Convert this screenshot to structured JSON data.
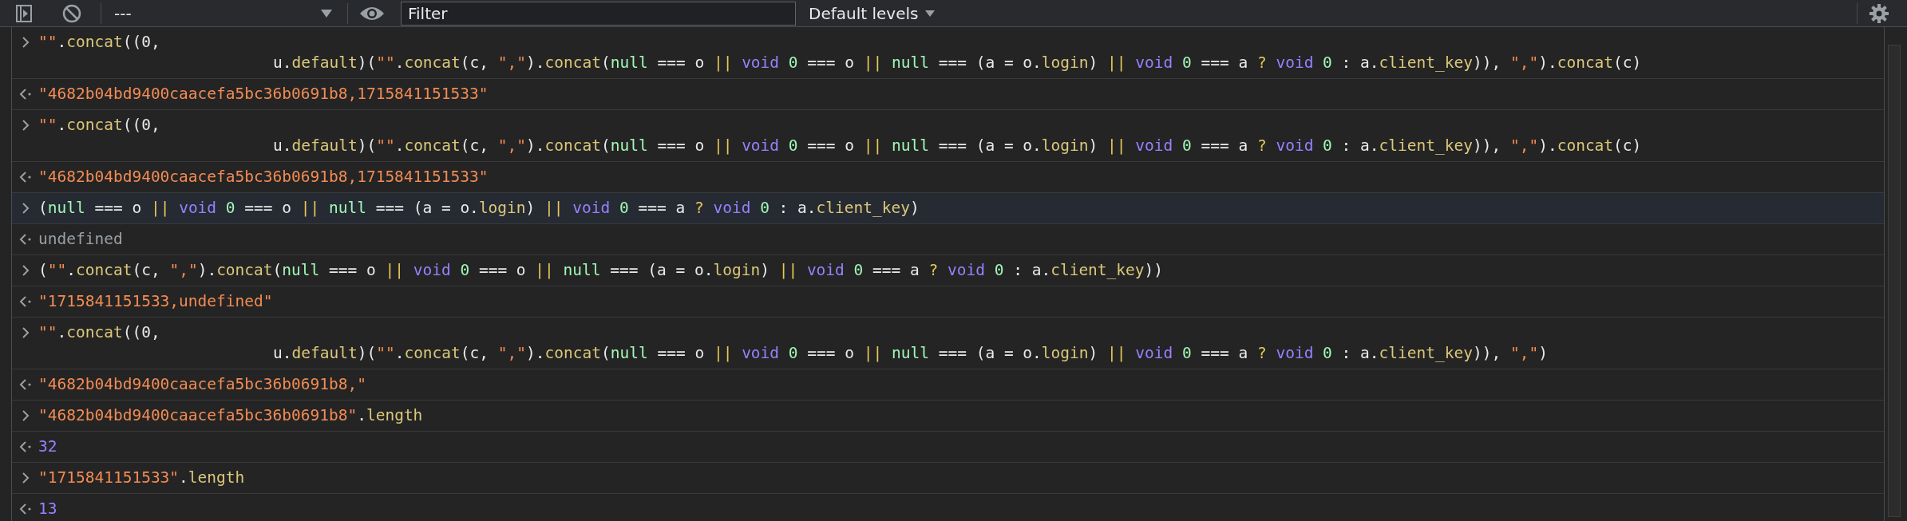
{
  "toolbar": {
    "context": "---",
    "filter": {
      "placeholder": "Filter"
    },
    "levels": "Default levels"
  },
  "messages": [
    {
      "kind": "input",
      "hovered": false,
      "lines": [
        {
          "indented": false,
          "tokens": [
            {
              "kind": "str",
              "text": "\"\""
            },
            {
              "kind": "plain",
              "text": "."
            },
            {
              "kind": "prop",
              "text": "concat"
            },
            {
              "kind": "plain",
              "text": "((0,"
            }
          ]
        },
        {
          "indented": true,
          "tokens": [
            {
              "kind": "plain",
              "text": "u."
            },
            {
              "kind": "prop",
              "text": "default"
            },
            {
              "kind": "plain",
              "text": ")("
            },
            {
              "kind": "str",
              "text": "\"\""
            },
            {
              "kind": "plain",
              "text": "."
            },
            {
              "kind": "prop",
              "text": "concat"
            },
            {
              "kind": "plain",
              "text": "(c, "
            },
            {
              "kind": "str",
              "text": "\",\""
            },
            {
              "kind": "plain",
              "text": ")."
            },
            {
              "kind": "prop",
              "text": "concat"
            },
            {
              "kind": "plain",
              "text": "("
            },
            {
              "kind": "lit",
              "text": "null"
            },
            {
              "kind": "plain",
              "text": " === o "
            },
            {
              "kind": "op",
              "text": "|| "
            },
            {
              "kind": "kw",
              "text": "void "
            },
            {
              "kind": "lit",
              "text": "0"
            },
            {
              "kind": "plain",
              "text": " === o "
            },
            {
              "kind": "op",
              "text": "|| "
            },
            {
              "kind": "lit",
              "text": "null"
            },
            {
              "kind": "plain",
              "text": " === (a = o."
            },
            {
              "kind": "prop",
              "text": "login"
            },
            {
              "kind": "plain",
              "text": ") "
            },
            {
              "kind": "op",
              "text": "|| "
            },
            {
              "kind": "kw",
              "text": "void "
            },
            {
              "kind": "lit",
              "text": "0"
            },
            {
              "kind": "plain",
              "text": " === a "
            },
            {
              "kind": "op",
              "text": "? "
            },
            {
              "kind": "kw",
              "text": "void "
            },
            {
              "kind": "lit",
              "text": "0"
            },
            {
              "kind": "plain",
              "text": " : a."
            },
            {
              "kind": "prop",
              "text": "client_key"
            },
            {
              "kind": "plain",
              "text": ")), "
            },
            {
              "kind": "str",
              "text": "\",\""
            },
            {
              "kind": "plain",
              "text": ")."
            },
            {
              "kind": "prop",
              "text": "concat"
            },
            {
              "kind": "plain",
              "text": "(c)"
            }
          ]
        }
      ]
    },
    {
      "kind": "output",
      "hovered": false,
      "lines": [
        {
          "indented": false,
          "tokens": [
            {
              "kind": "str",
              "text": "\"4682b04bd9400caacefa5bc36b0691b8,1715841151533\""
            }
          ]
        }
      ]
    },
    {
      "kind": "input",
      "hovered": false,
      "lines": [
        {
          "indented": false,
          "tokens": [
            {
              "kind": "str",
              "text": "\"\""
            },
            {
              "kind": "plain",
              "text": "."
            },
            {
              "kind": "prop",
              "text": "concat"
            },
            {
              "kind": "plain",
              "text": "((0,"
            }
          ]
        },
        {
          "indented": true,
          "tokens": [
            {
              "kind": "plain",
              "text": "u."
            },
            {
              "kind": "prop",
              "text": "default"
            },
            {
              "kind": "plain",
              "text": ")("
            },
            {
              "kind": "str",
              "text": "\"\""
            },
            {
              "kind": "plain",
              "text": "."
            },
            {
              "kind": "prop",
              "text": "concat"
            },
            {
              "kind": "plain",
              "text": "(c, "
            },
            {
              "kind": "str",
              "text": "\",\""
            },
            {
              "kind": "plain",
              "text": ")."
            },
            {
              "kind": "prop",
              "text": "concat"
            },
            {
              "kind": "plain",
              "text": "("
            },
            {
              "kind": "lit",
              "text": "null"
            },
            {
              "kind": "plain",
              "text": " === o "
            },
            {
              "kind": "op",
              "text": "|| "
            },
            {
              "kind": "kw",
              "text": "void "
            },
            {
              "kind": "lit",
              "text": "0"
            },
            {
              "kind": "plain",
              "text": " === o "
            },
            {
              "kind": "op",
              "text": "|| "
            },
            {
              "kind": "lit",
              "text": "null"
            },
            {
              "kind": "plain",
              "text": " === (a = o."
            },
            {
              "kind": "prop",
              "text": "login"
            },
            {
              "kind": "plain",
              "text": ") "
            },
            {
              "kind": "op",
              "text": "|| "
            },
            {
              "kind": "kw",
              "text": "void "
            },
            {
              "kind": "lit",
              "text": "0"
            },
            {
              "kind": "plain",
              "text": " === a "
            },
            {
              "kind": "op",
              "text": "? "
            },
            {
              "kind": "kw",
              "text": "void "
            },
            {
              "kind": "lit",
              "text": "0"
            },
            {
              "kind": "plain",
              "text": " : a."
            },
            {
              "kind": "prop",
              "text": "client_key"
            },
            {
              "kind": "plain",
              "text": ")), "
            },
            {
              "kind": "str",
              "text": "\",\""
            },
            {
              "kind": "plain",
              "text": ")."
            },
            {
              "kind": "prop",
              "text": "concat"
            },
            {
              "kind": "plain",
              "text": "(c)"
            }
          ]
        }
      ]
    },
    {
      "kind": "output",
      "hovered": false,
      "lines": [
        {
          "indented": false,
          "tokens": [
            {
              "kind": "str",
              "text": "\"4682b04bd9400caacefa5bc36b0691b8,1715841151533\""
            }
          ]
        }
      ]
    },
    {
      "kind": "input",
      "hovered": true,
      "lines": [
        {
          "indented": false,
          "tokens": [
            {
              "kind": "plain",
              "text": "("
            },
            {
              "kind": "lit",
              "text": "null"
            },
            {
              "kind": "plain",
              "text": " === o "
            },
            {
              "kind": "op",
              "text": "|| "
            },
            {
              "kind": "kw",
              "text": "void "
            },
            {
              "kind": "lit",
              "text": "0"
            },
            {
              "kind": "plain",
              "text": " === o "
            },
            {
              "kind": "op",
              "text": "|| "
            },
            {
              "kind": "lit",
              "text": "null"
            },
            {
              "kind": "plain",
              "text": " === (a = o."
            },
            {
              "kind": "prop",
              "text": "login"
            },
            {
              "kind": "plain",
              "text": ") "
            },
            {
              "kind": "op",
              "text": "|| "
            },
            {
              "kind": "kw",
              "text": "void "
            },
            {
              "kind": "lit",
              "text": "0"
            },
            {
              "kind": "plain",
              "text": " === a "
            },
            {
              "kind": "op",
              "text": "? "
            },
            {
              "kind": "kw",
              "text": "void "
            },
            {
              "kind": "lit",
              "text": "0"
            },
            {
              "kind": "plain",
              "text": " : a."
            },
            {
              "kind": "prop",
              "text": "client_key"
            },
            {
              "kind": "plain",
              "text": ")"
            }
          ]
        }
      ]
    },
    {
      "kind": "output",
      "hovered": false,
      "lines": [
        {
          "indented": false,
          "tokens": [
            {
              "kind": "undef",
              "text": "undefined"
            }
          ]
        }
      ]
    },
    {
      "kind": "input",
      "hovered": false,
      "lines": [
        {
          "indented": false,
          "tokens": [
            {
              "kind": "plain",
              "text": "("
            },
            {
              "kind": "str",
              "text": "\"\""
            },
            {
              "kind": "plain",
              "text": "."
            },
            {
              "kind": "prop",
              "text": "concat"
            },
            {
              "kind": "plain",
              "text": "(c, "
            },
            {
              "kind": "str",
              "text": "\",\""
            },
            {
              "kind": "plain",
              "text": ")."
            },
            {
              "kind": "prop",
              "text": "concat"
            },
            {
              "kind": "plain",
              "text": "("
            },
            {
              "kind": "lit",
              "text": "null"
            },
            {
              "kind": "plain",
              "text": " === o "
            },
            {
              "kind": "op",
              "text": "|| "
            },
            {
              "kind": "kw",
              "text": "void "
            },
            {
              "kind": "lit",
              "text": "0"
            },
            {
              "kind": "plain",
              "text": " === o "
            },
            {
              "kind": "op",
              "text": "|| "
            },
            {
              "kind": "lit",
              "text": "null"
            },
            {
              "kind": "plain",
              "text": " === (a = o."
            },
            {
              "kind": "prop",
              "text": "login"
            },
            {
              "kind": "plain",
              "text": ") "
            },
            {
              "kind": "op",
              "text": "|| "
            },
            {
              "kind": "kw",
              "text": "void "
            },
            {
              "kind": "lit",
              "text": "0"
            },
            {
              "kind": "plain",
              "text": " === a "
            },
            {
              "kind": "op",
              "text": "? "
            },
            {
              "kind": "kw",
              "text": "void "
            },
            {
              "kind": "lit",
              "text": "0"
            },
            {
              "kind": "plain",
              "text": " : a."
            },
            {
              "kind": "prop",
              "text": "client_key"
            },
            {
              "kind": "plain",
              "text": "))"
            }
          ]
        }
      ]
    },
    {
      "kind": "output",
      "hovered": false,
      "lines": [
        {
          "indented": false,
          "tokens": [
            {
              "kind": "str",
              "text": "\"1715841151533,undefined\""
            }
          ]
        }
      ]
    },
    {
      "kind": "input",
      "hovered": false,
      "lines": [
        {
          "indented": false,
          "tokens": [
            {
              "kind": "str",
              "text": "\"\""
            },
            {
              "kind": "plain",
              "text": "."
            },
            {
              "kind": "prop",
              "text": "concat"
            },
            {
              "kind": "plain",
              "text": "((0,"
            }
          ]
        },
        {
          "indented": true,
          "tokens": [
            {
              "kind": "plain",
              "text": "u."
            },
            {
              "kind": "prop",
              "text": "default"
            },
            {
              "kind": "plain",
              "text": ")("
            },
            {
              "kind": "str",
              "text": "\"\""
            },
            {
              "kind": "plain",
              "text": "."
            },
            {
              "kind": "prop",
              "text": "concat"
            },
            {
              "kind": "plain",
              "text": "(c, "
            },
            {
              "kind": "str",
              "text": "\",\""
            },
            {
              "kind": "plain",
              "text": ")."
            },
            {
              "kind": "prop",
              "text": "concat"
            },
            {
              "kind": "plain",
              "text": "("
            },
            {
              "kind": "lit",
              "text": "null"
            },
            {
              "kind": "plain",
              "text": " === o "
            },
            {
              "kind": "op",
              "text": "|| "
            },
            {
              "kind": "kw",
              "text": "void "
            },
            {
              "kind": "lit",
              "text": "0"
            },
            {
              "kind": "plain",
              "text": " === o "
            },
            {
              "kind": "op",
              "text": "|| "
            },
            {
              "kind": "lit",
              "text": "null"
            },
            {
              "kind": "plain",
              "text": " === (a = o."
            },
            {
              "kind": "prop",
              "text": "login"
            },
            {
              "kind": "plain",
              "text": ") "
            },
            {
              "kind": "op",
              "text": "|| "
            },
            {
              "kind": "kw",
              "text": "void "
            },
            {
              "kind": "lit",
              "text": "0"
            },
            {
              "kind": "plain",
              "text": " === a "
            },
            {
              "kind": "op",
              "text": "? "
            },
            {
              "kind": "kw",
              "text": "void "
            },
            {
              "kind": "lit",
              "text": "0"
            },
            {
              "kind": "plain",
              "text": " : a."
            },
            {
              "kind": "prop",
              "text": "client_key"
            },
            {
              "kind": "plain",
              "text": ")), "
            },
            {
              "kind": "str",
              "text": "\",\""
            },
            {
              "kind": "plain",
              "text": ")"
            }
          ]
        }
      ]
    },
    {
      "kind": "output",
      "hovered": false,
      "lines": [
        {
          "indented": false,
          "tokens": [
            {
              "kind": "str",
              "text": "\"4682b04bd9400caacefa5bc36b0691b8,\""
            }
          ]
        }
      ]
    },
    {
      "kind": "input",
      "hovered": false,
      "lines": [
        {
          "indented": false,
          "tokens": [
            {
              "kind": "str",
              "text": "\"4682b04bd9400caacefa5bc36b0691b8\""
            },
            {
              "kind": "plain",
              "text": "."
            },
            {
              "kind": "prop",
              "text": "length"
            }
          ]
        }
      ]
    },
    {
      "kind": "output",
      "hovered": false,
      "lines": [
        {
          "indented": false,
          "tokens": [
            {
              "kind": "num",
              "text": "32"
            }
          ]
        }
      ]
    },
    {
      "kind": "input",
      "hovered": false,
      "lines": [
        {
          "indented": false,
          "tokens": [
            {
              "kind": "str",
              "text": "\"1715841151533\""
            },
            {
              "kind": "plain",
              "text": "."
            },
            {
              "kind": "prop",
              "text": "length"
            }
          ]
        }
      ]
    },
    {
      "kind": "output",
      "hovered": false,
      "lines": [
        {
          "indented": false,
          "tokens": [
            {
              "kind": "num",
              "text": "13"
            }
          ]
        }
      ]
    }
  ]
}
